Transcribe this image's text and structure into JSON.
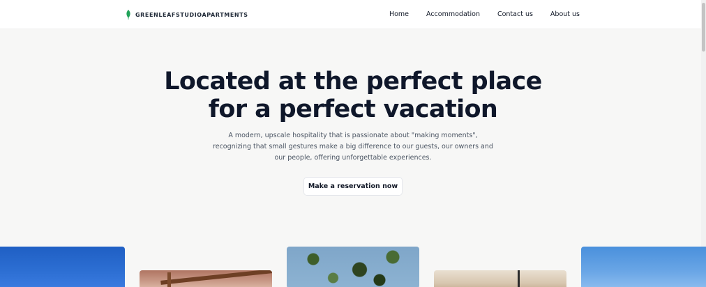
{
  "brand": {
    "name": "GREENLEAFSTUDIOAPARTMENTS",
    "logo_icon": "leaf-icon",
    "accent_color": "#22a35a"
  },
  "nav": {
    "items": [
      {
        "label": "Home"
      },
      {
        "label": "Accommodation"
      },
      {
        "label": "Contact us"
      },
      {
        "label": "About us"
      }
    ]
  },
  "hero": {
    "title_line1": "Located at the perfect place",
    "title_line2": "for a perfect vacation",
    "subtitle_line1": "A modern, upscale hospitality that is passionate about \"making moments\",",
    "subtitle_line2": "recognizing that small gestures make a big difference to our guests, our owners and",
    "subtitle_line3": "our people, offering unforgettable experiences.",
    "cta_label": "Make a reservation now"
  }
}
